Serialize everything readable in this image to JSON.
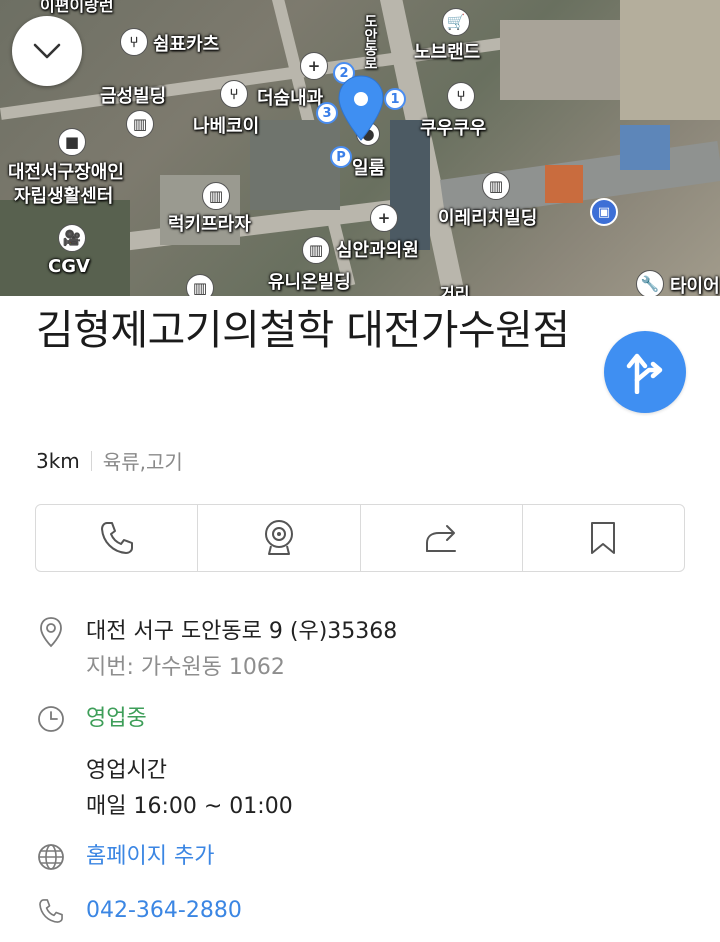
{
  "map": {
    "labels": {
      "top_cut": "이편이랑런",
      "ssupyo": "쉼표카츠",
      "geumseong": "금성빌딩",
      "deosum": "더숨내과",
      "nabekoi": "나베코이",
      "nobrand": "노브랜드",
      "kuukuu": "쿠우쿠우",
      "daejeon_center_1": "대전서구장애인",
      "daejeon_center_2": "자립생활센터",
      "lucky": "럭키프라자",
      "ireri": "이레리치빌딩",
      "cgv": "CGV",
      "sim": "심안과의원",
      "union": "유니온빌딩",
      "tai": "타이어",
      "ilrum": "일룸",
      "road": "도안동로",
      "geori": "거리"
    },
    "pins": [
      "1",
      "2",
      "3",
      "P"
    ]
  },
  "place": {
    "title": "김형제고기의철학 대전가수원점",
    "distance": "3km",
    "category": "육류,고기"
  },
  "address": {
    "main": "대전 서구 도안동로 9 (우)35368",
    "lot": "지번: 가수원동 1062"
  },
  "status": {
    "open": "영업중",
    "hours_label": "영업시간",
    "hours": "매일 16:00 ~ 01:00"
  },
  "homepage": "홈페이지 추가",
  "phone": "042-364-2880",
  "colors": {
    "accent": "#3f8ff2",
    "open_green": "#3e9e59",
    "link_blue": "#3b86e3"
  }
}
